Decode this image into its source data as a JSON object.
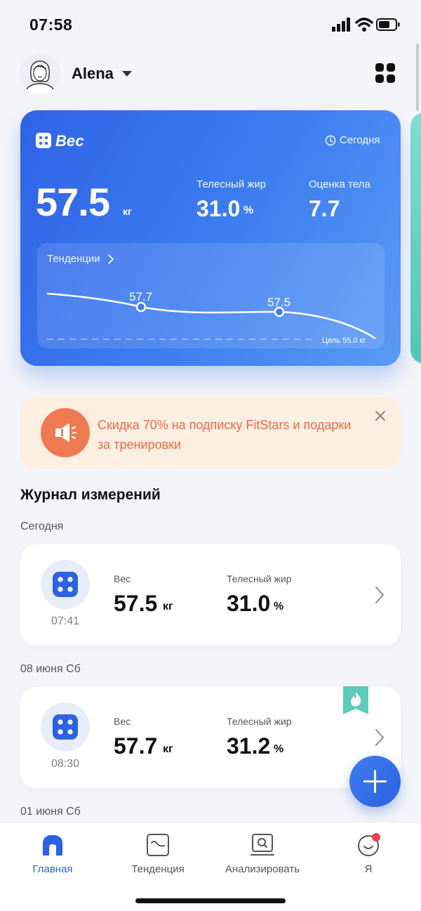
{
  "status_bar": {
    "time": "07:58"
  },
  "header": {
    "user_name": "Alena"
  },
  "weight_card": {
    "title": "Вес",
    "date_label": "Сегодня",
    "weight_value": "57.5",
    "weight_unit": "кг",
    "body_fat_label": "Телесный жир",
    "body_fat_value": "31.0",
    "body_fat_unit": "%",
    "body_score_label": "Оценка тела",
    "body_score_value": "7.7",
    "trend_label": "Тенденции",
    "trend_points": [
      {
        "label": "57.7",
        "value": 57.7
      },
      {
        "label": "57.5",
        "value": 57.5
      }
    ],
    "goal_label": "Цель 55.0 кг"
  },
  "promo": {
    "text": "Скидка 70% на подписку FitStars и подарки за тренировки"
  },
  "log": {
    "title": "Журнал измерений",
    "groups": [
      {
        "date": "Сегодня",
        "entry": {
          "time": "07:41",
          "weight_label": "Вес",
          "weight_value": "57.5",
          "weight_unit": "кг",
          "fat_label": "Телесный жир",
          "fat_value": "31.0",
          "fat_unit": "%"
        }
      },
      {
        "date": "08 июня Сб",
        "entry": {
          "time": "08:30",
          "weight_label": "Вес",
          "weight_value": "57.7",
          "weight_unit": "кг",
          "fat_label": "Телесный жир",
          "fat_value": "31.2",
          "fat_unit": "%"
        }
      },
      {
        "date": "01 июня Сб"
      }
    ]
  },
  "nav": {
    "tabs": [
      {
        "label": "Главная",
        "active": true
      },
      {
        "label": "Тенденция"
      },
      {
        "label": "Анализировать"
      },
      {
        "label": "Я"
      }
    ]
  },
  "colors": {
    "accent": "#2d63e3",
    "promo_text": "#ea6c44",
    "badge": "#e8414f",
    "teal": "#5ccbb9"
  },
  "icons": [
    "scale-icon",
    "clock-icon",
    "chevron-right-icon",
    "megaphone-icon",
    "close-icon",
    "plus-icon",
    "home-icon",
    "trend-icon",
    "analyze-icon",
    "profile-icon",
    "grid-icon",
    "flame-ribbon-icon"
  ]
}
